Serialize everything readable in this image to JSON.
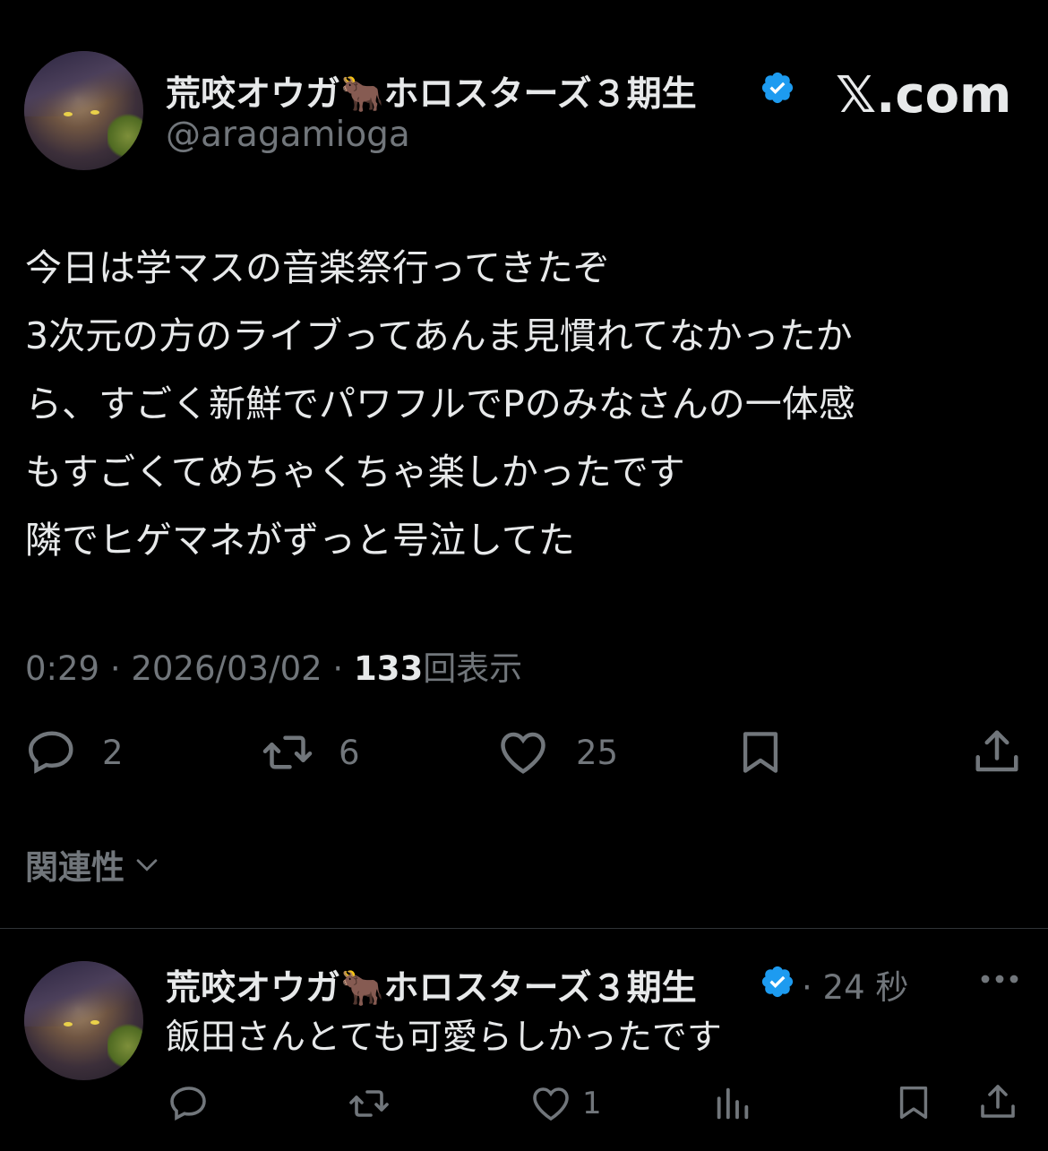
{
  "tweet": {
    "author_name": "荒咬オウガ🐂ホロスターズ３期生",
    "handle": "@aragamioga",
    "site_logo": "𝕏.com",
    "body_lines": [
      "今日は学マスの音楽祭行ってきたぞ",
      "3次元の方のライブってあんま見慣れてなかったか",
      "ら、すごく新鮮でパワフルでPのみなさんの一体感",
      "もすごくてめちゃくちゃ楽しかったです",
      "隣でヒゲマネがずっと号泣してた"
    ],
    "time": "0:29",
    "date": "2026/03/02",
    "sep": "·",
    "views_count": "133",
    "views_label": "回表示",
    "replies": "2",
    "retweets": "6",
    "likes": "25"
  },
  "sort": {
    "label": "関連性"
  },
  "reply": {
    "author_name": "荒咬オウガ🐂ホロスターズ３期生",
    "time_ago": "· 24 秒",
    "text": "飯田さんとても可愛らしかったです",
    "likes": "1"
  },
  "colors": {
    "background": "#000000",
    "text": "#e7e9ea",
    "muted": "#71767b",
    "verified": "#1d9bf0",
    "divider": "#2f3336"
  }
}
